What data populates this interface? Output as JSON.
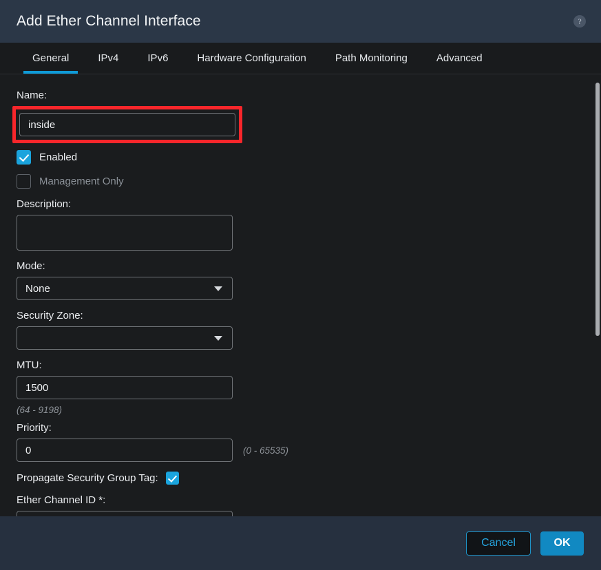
{
  "dialog": {
    "title": "Add Ether Channel Interface",
    "help_icon": "help-circle-icon"
  },
  "tabs": [
    {
      "label": "General",
      "active": true
    },
    {
      "label": "IPv4",
      "active": false
    },
    {
      "label": "IPv6",
      "active": false
    },
    {
      "label": "Hardware Configuration",
      "active": false
    },
    {
      "label": "Path Monitoring",
      "active": false
    },
    {
      "label": "Advanced",
      "active": false
    }
  ],
  "form": {
    "name_label": "Name:",
    "name_value": "inside",
    "enabled_label": "Enabled",
    "enabled_checked": true,
    "management_only_label": "Management Only",
    "management_only_checked": false,
    "description_label": "Description:",
    "description_value": "",
    "mode_label": "Mode:",
    "mode_value": "None",
    "security_zone_label": "Security Zone:",
    "security_zone_value": "",
    "mtu_label": "MTU:",
    "mtu_value": "1500",
    "mtu_hint": "(64 - 9198)",
    "priority_label": "Priority:",
    "priority_value": "0",
    "priority_hint": "(0 - 65535)",
    "propagate_sgt_label": "Propagate Security Group Tag:",
    "propagate_sgt_checked": true,
    "ether_channel_id_label": "Ether Channel ID *:",
    "ether_channel_id_value": ""
  },
  "footer": {
    "cancel_label": "Cancel",
    "ok_label": "OK"
  },
  "colors": {
    "accent": "#0f9bd7",
    "highlight": "#f8262b",
    "header_bg": "#2b3747",
    "footer_bg": "#26303f",
    "ok_button": "#1189c2"
  }
}
